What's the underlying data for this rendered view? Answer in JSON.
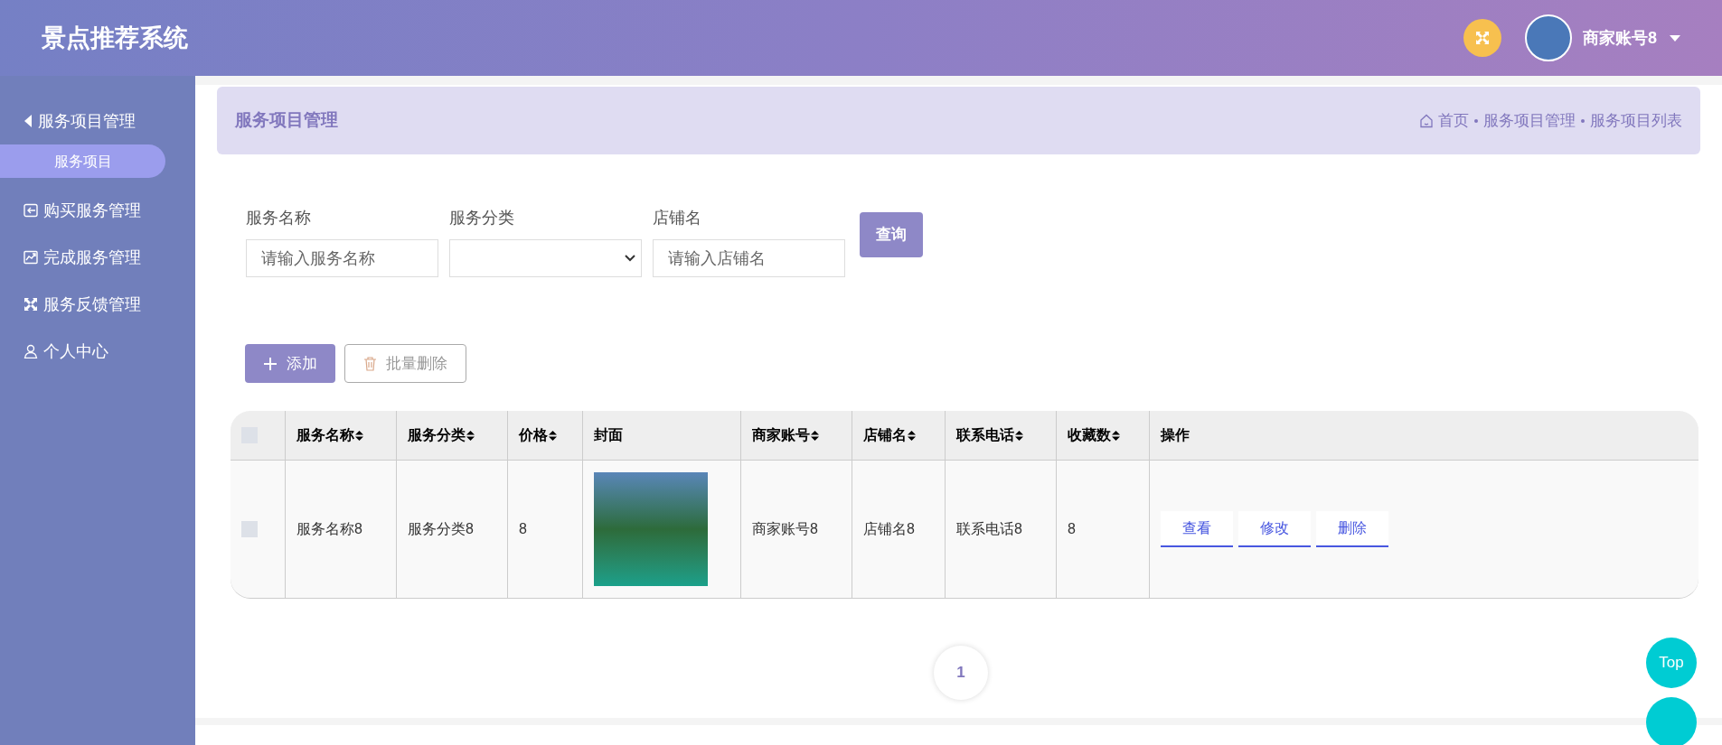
{
  "header": {
    "title": "景点推荐系统",
    "user": "商家账号8"
  },
  "sidebar": {
    "items": [
      {
        "kind": "caret",
        "label": "服务项目管理",
        "children": [
          {
            "label": "服务项目",
            "selected": true
          }
        ]
      },
      {
        "kind": "enter",
        "label": "购买服务管理"
      },
      {
        "kind": "chart",
        "label": "完成服务管理"
      },
      {
        "kind": "arrows",
        "label": "服务反馈管理"
      },
      {
        "kind": "user",
        "label": "个人中心"
      }
    ]
  },
  "page_header": {
    "title": "服务项目管理",
    "breadcrumb": [
      "首页",
      "服务项目管理",
      "服务项目列表"
    ]
  },
  "search": {
    "fields": [
      {
        "kind": "text",
        "label": "服务名称",
        "placeholder": "请输入服务名称"
      },
      {
        "kind": "select",
        "label": "服务分类"
      },
      {
        "kind": "text",
        "label": "店铺名",
        "placeholder": "请输入店铺名"
      }
    ],
    "button": "查询"
  },
  "actions": [
    {
      "kind": "add",
      "label": "添加",
      "disabled": false
    },
    {
      "kind": "delete",
      "label": "批量删除",
      "disabled": true
    }
  ],
  "table": {
    "all_checked": false,
    "columns": [
      {
        "label": "服务名称",
        "sortable": true
      },
      {
        "label": "服务分类",
        "sortable": true
      },
      {
        "label": "价格",
        "sortable": true
      },
      {
        "label": "封面",
        "sortable": false
      },
      {
        "label": "商家账号",
        "sortable": true
      },
      {
        "label": "店铺名",
        "sortable": true
      },
      {
        "label": "联系电话",
        "sortable": true
      },
      {
        "label": "收藏数",
        "sortable": true
      },
      {
        "label": "操作",
        "sortable": false
      }
    ],
    "rows": [
      {
        "checked": false,
        "cells": [
          "服务名称8",
          "服务分类8",
          "8",
          null,
          "商家账号8",
          "店铺名8",
          "联系电话8",
          "8"
        ],
        "actions": [
          "查看",
          "修改",
          "删除"
        ]
      }
    ]
  },
  "pagination": {
    "pages": [
      {
        "label": "1",
        "selected": true
      }
    ]
  },
  "float_buttons": [
    "Top"
  ]
}
